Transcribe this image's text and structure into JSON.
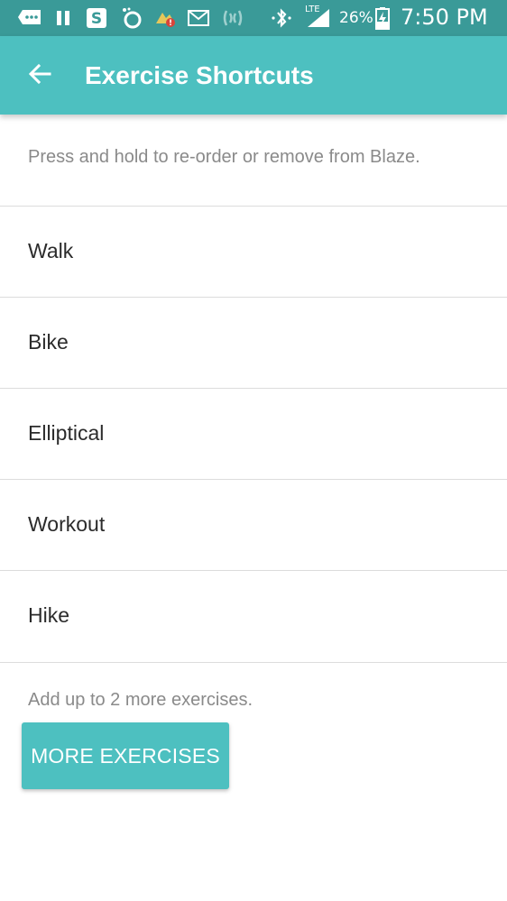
{
  "status_bar": {
    "time": "7:50 PM",
    "battery_percent": "26%",
    "network": "LTE",
    "icons": [
      "chat-icon",
      "pause-icon",
      "s-app-icon",
      "sync-icon",
      "weather-alert-icon",
      "mail-icon",
      "nfc-icon",
      "bluetooth-icon",
      "signal-icon",
      "battery-charging-icon"
    ]
  },
  "app_bar": {
    "title": "Exercise Shortcuts",
    "back_icon": "back-arrow-icon"
  },
  "instructions": "Press and hold to re-order or remove from Blaze.",
  "exercises": [
    {
      "label": "Walk"
    },
    {
      "label": "Bike"
    },
    {
      "label": "Elliptical"
    },
    {
      "label": "Workout"
    },
    {
      "label": "Hike"
    }
  ],
  "add_note": "Add up to 2 more exercises.",
  "more_button_label": "MORE EXERCISES",
  "colors": {
    "status_bar": "#3a9a98",
    "accent": "#4dc0c0",
    "primary_text": "#2b2b2b",
    "secondary_text": "#8a8a8a",
    "divider": "#dcdcdc"
  }
}
